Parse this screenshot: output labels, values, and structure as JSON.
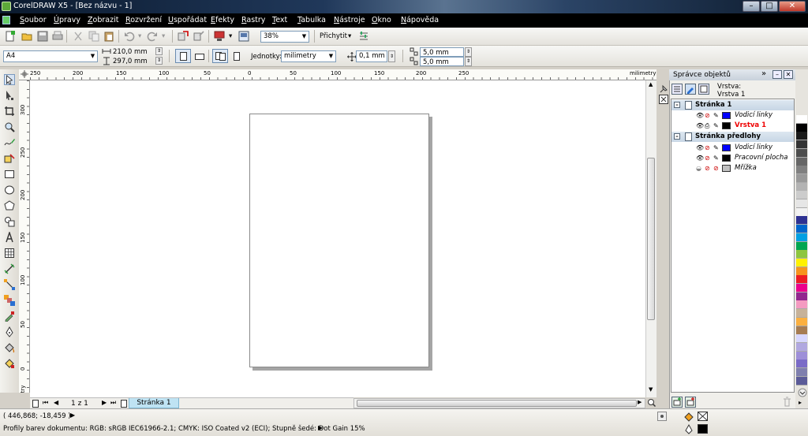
{
  "window": {
    "title": "CorelDRAW X5 - [Bez názvu - 1]",
    "min": "–",
    "max": "□",
    "close": "✕"
  },
  "menu": [
    "Soubor",
    "Úpravy",
    "Zobrazit",
    "Rozvržení",
    "Uspořádat",
    "Efekty",
    "Rastry",
    "Text",
    "Tabulka",
    "Nástroje",
    "Okno",
    "Nápověda"
  ],
  "toolbar": {
    "zoom": "38%",
    "snap_label": "Přichytit"
  },
  "property_bar": {
    "page_size": "A4",
    "width": "210,0 mm",
    "height": "297,0 mm",
    "units_label": "Jednotky:",
    "units_value": "milimetry",
    "nudge": "0,1 mm",
    "dup_x": "5,0 mm",
    "dup_y": "5,0 mm"
  },
  "ruler": {
    "h_ticks": [
      "250",
      "200",
      "150",
      "100",
      "50",
      "0",
      "50",
      "100",
      "150",
      "200",
      "250"
    ],
    "h_unit": "milimetry",
    "v_ticks": [
      "300",
      "250",
      "200",
      "150",
      "100",
      "50",
      "0"
    ],
    "v_unit": "milimetry"
  },
  "page_nav": {
    "counter": "1 z 1",
    "tab": "Stránka 1"
  },
  "docker": {
    "title": "Správce objektů",
    "layer_label": "Vrstva:",
    "layer_value": "Vrstva 1",
    "tree": [
      {
        "label": "Stránka 1",
        "kind": "page"
      },
      {
        "label": "Vodicí linky",
        "kind": "layer",
        "color": "#0000ff"
      },
      {
        "label": "Vrstva 1",
        "kind": "layer-active",
        "color": "#000000"
      },
      {
        "label": "Stránka předlohy",
        "kind": "page"
      },
      {
        "label": "Vodicí linky",
        "kind": "layer",
        "color": "#0000ff"
      },
      {
        "label": "Pracovní plocha",
        "kind": "layer",
        "color": "#000000"
      },
      {
        "label": "Mřížka",
        "kind": "layer",
        "color": "#c0c0c0"
      }
    ]
  },
  "palette": [
    "#ffffff",
    "#000000",
    "#1a1a1a",
    "#333333",
    "#4d4d4d",
    "#666666",
    "#808080",
    "#999999",
    "#b3b3b3",
    "#cccccc",
    "#e6e6e6",
    "#f2f2f2",
    "#2e3192",
    "#0066cc",
    "#00a0e3",
    "#00a651",
    "#8dc63f",
    "#fff200",
    "#f7941d",
    "#ed1c24",
    "#ec008c",
    "#92278f",
    "#f49ac1",
    "#c7b299",
    "#fbb040",
    "#a67c52",
    "#d7d7ff",
    "#b1a8e0",
    "#9e8fd8",
    "#7a6bc7",
    "#7f7fae",
    "#5b5b98"
  ],
  "status": {
    "coords": "( 446,868; -18,459 )",
    "profile": "Profily barev dokumentu: RGB: sRGB IEC61966-2.1; CMYK: ISO Coated v2 (ECI); Stupně šedé: Dot Gain 15%"
  }
}
